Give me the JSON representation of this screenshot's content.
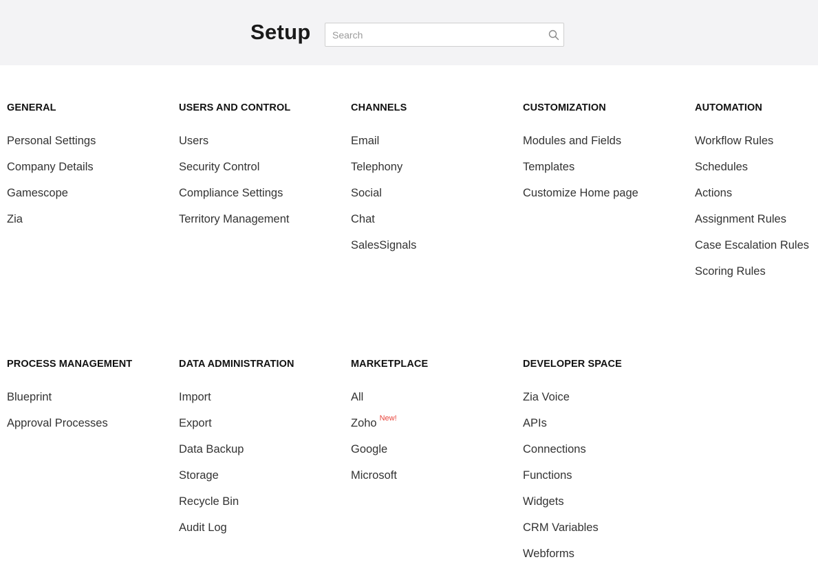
{
  "header": {
    "title": "Setup",
    "search_placeholder": "Search",
    "search_icon": "search-icon"
  },
  "sections": [
    {
      "title": "GENERAL",
      "items": [
        "Personal Settings",
        "Company Details",
        "Gamescope",
        "Zia"
      ]
    },
    {
      "title": "USERS AND CONTROL",
      "items": [
        "Users",
        "Security Control",
        "Compliance Settings",
        "Territory Management"
      ]
    },
    {
      "title": "CHANNELS",
      "items": [
        "Email",
        "Telephony",
        "Social",
        "Chat",
        "SalesSignals"
      ]
    },
    {
      "title": "CUSTOMIZATION",
      "items": [
        "Modules and Fields",
        "Templates",
        "Customize Home page"
      ]
    },
    {
      "title": "AUTOMATION",
      "items": [
        "Workflow Rules",
        "Schedules",
        "Actions",
        "Assignment Rules",
        "Case Escalation Rules",
        "Scoring Rules"
      ]
    },
    {
      "title": "PROCESS MANAGEMENT",
      "items": [
        "Blueprint",
        "Approval Processes"
      ]
    },
    {
      "title": "DATA ADMINISTRATION",
      "items": [
        "Import",
        "Export",
        "Data Backup",
        "Storage",
        "Recycle Bin",
        "Audit Log"
      ]
    },
    {
      "title": "MARKETPLACE",
      "items": [
        "All",
        "Zoho",
        "Google",
        "Microsoft"
      ],
      "badge": "New!"
    },
    {
      "title": "DEVELOPER SPACE",
      "items": [
        "Zia Voice",
        "APIs",
        "Connections",
        "Functions",
        "Widgets",
        "CRM Variables",
        "Webforms"
      ]
    }
  ],
  "colors": {
    "header_bg": "#f3f3f5",
    "badge": "#e8453c"
  }
}
